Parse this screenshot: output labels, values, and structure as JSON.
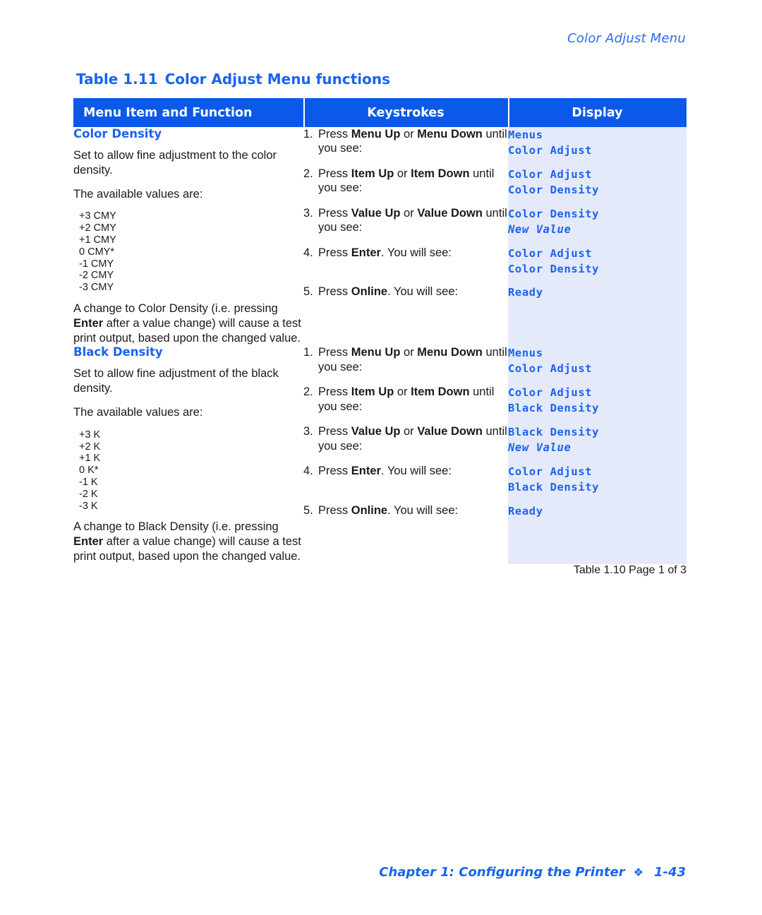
{
  "running_header": "Color Adjust Menu",
  "table_caption": {
    "number": "Table 1.11",
    "title": "Color Adjust Menu functions"
  },
  "table_headers": {
    "col1": "Menu Item and Function",
    "col2": "Keystrokes",
    "col3": "Display"
  },
  "sections": [
    {
      "title": "Color Density",
      "description": "Set to allow fine adjustment to the color density.",
      "values_intro": "The available values are:",
      "values": [
        "+3 CMY",
        "+2 CMY",
        "+1 CMY",
        "0 CMY*",
        "-1 CMY",
        "-2 CMY",
        "-3 CMY"
      ],
      "note_a": "A change to Color Density (i.e. pressing ",
      "note_kw": "Enter",
      "note_b": " after a value change) will cause a test print output, based upon the changed value.",
      "steps": [
        {
          "num": "1.",
          "text_a": "Press ",
          "kw1": "Menu Up",
          "mid": " or ",
          "kw2": "Menu Down",
          "text_b": " until you see:",
          "display": [
            "Menus",
            "Color Adjust"
          ],
          "display_italic": [
            false,
            false
          ]
        },
        {
          "num": "2.",
          "text_a": "Press ",
          "kw1": "Item Up",
          "mid": " or ",
          "kw2": "Item Down",
          "text_b": " until you see:",
          "display": [
            "Color Adjust",
            "Color Density"
          ],
          "display_italic": [
            false,
            false
          ]
        },
        {
          "num": "3.",
          "text_a": "Press ",
          "kw1": "Value Up",
          "mid": " or ",
          "kw2": "Value Down",
          "text_b": " until you see:",
          "display": [
            "Color Density",
            "New Value"
          ],
          "display_italic": [
            false,
            true
          ]
        },
        {
          "num": "4.",
          "text_a": "Press ",
          "kw1": "Enter",
          "mid": "",
          "kw2": "",
          "text_b": ". You will see:",
          "display": [
            "Color Adjust",
            "Color Density"
          ],
          "display_italic": [
            false,
            false
          ]
        },
        {
          "num": "5.",
          "text_a": "Press ",
          "kw1": "Online",
          "mid": "",
          "kw2": "",
          "text_b": ". You will see:",
          "display": [
            "Ready"
          ],
          "display_italic": [
            false
          ]
        }
      ]
    },
    {
      "title": "Black Density",
      "description": "Set to allow fine adjustment of the black density.",
      "values_intro": "The available values are:",
      "values": [
        "+3 K",
        "+2 K",
        "+1 K",
        "0 K*",
        "-1 K",
        "-2 K",
        "-3 K"
      ],
      "note_a": "A change to Black Density (i.e. pressing ",
      "note_kw": "Enter",
      "note_b": " after a value change) will cause a test print output, based upon the changed value.",
      "steps": [
        {
          "num": "1.",
          "text_a": "Press ",
          "kw1": "Menu Up",
          "mid": " or ",
          "kw2": "Menu Down",
          "text_b": " until you see:",
          "display": [
            "Menus",
            "Color Adjust"
          ],
          "display_italic": [
            false,
            false
          ]
        },
        {
          "num": "2.",
          "text_a": "Press ",
          "kw1": "Item Up",
          "mid": " or ",
          "kw2": "Item Down",
          "text_b": " until you see:",
          "display": [
            "Color Adjust",
            "Black Density"
          ],
          "display_italic": [
            false,
            false
          ]
        },
        {
          "num": "3.",
          "text_a": "Press ",
          "kw1": "Value Up",
          "mid": " or ",
          "kw2": "Value Down",
          "text_b": " until you see:",
          "display": [
            "Black Density",
            "New Value"
          ],
          "display_italic": [
            false,
            true
          ]
        },
        {
          "num": "4.",
          "text_a": "Press ",
          "kw1": "Enter",
          "mid": "",
          "kw2": "",
          "text_b": ". You will see:",
          "display": [
            "Color Adjust",
            "Black Density"
          ],
          "display_italic": [
            false,
            false
          ]
        },
        {
          "num": "5.",
          "text_a": "Press ",
          "kw1": "Online",
          "mid": "",
          "kw2": "",
          "text_b": ". You will see:",
          "display": [
            "Ready"
          ],
          "display_italic": [
            false
          ]
        }
      ]
    }
  ],
  "table_footer_note": "Table 1.10  Page 1 of 3",
  "page_footer": {
    "chapter": "Chapter 1: Configuring the Printer",
    "separator": "❖",
    "page_number": "1-43"
  },
  "colors": {
    "header_blue": "#0b59e8",
    "accent_blue": "#1a63ef",
    "display_bg": "#e4eafa",
    "border_blue": "#b9cdf5"
  }
}
